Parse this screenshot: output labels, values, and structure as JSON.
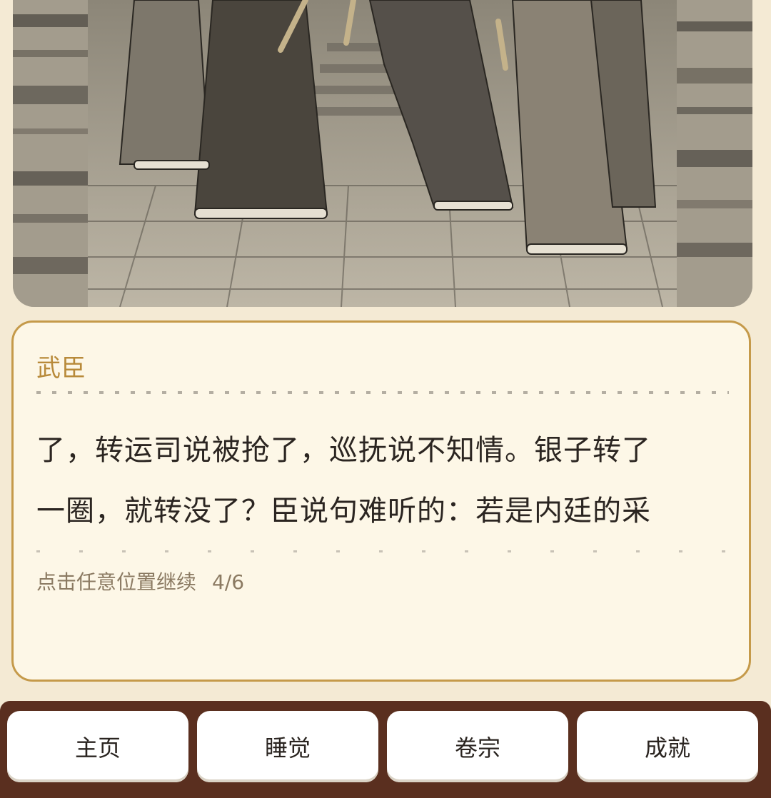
{
  "dialog": {
    "speaker": "武臣",
    "lines": [
      "了，转运司说被抢了，巡抚说不知情。银子转了",
      "一圈，就转没了？臣说句难听的：若是内廷的采"
    ],
    "hint": "点击任意位置继续",
    "progress": "4/6"
  },
  "nav": {
    "items": [
      "主页",
      "睡觉",
      "卷宗",
      "成就"
    ]
  },
  "colors": {
    "background": "#f4ead4",
    "dialog_border": "#c59a4a",
    "speaker": "#b88a3a",
    "navbar": "#5a2f1f"
  }
}
